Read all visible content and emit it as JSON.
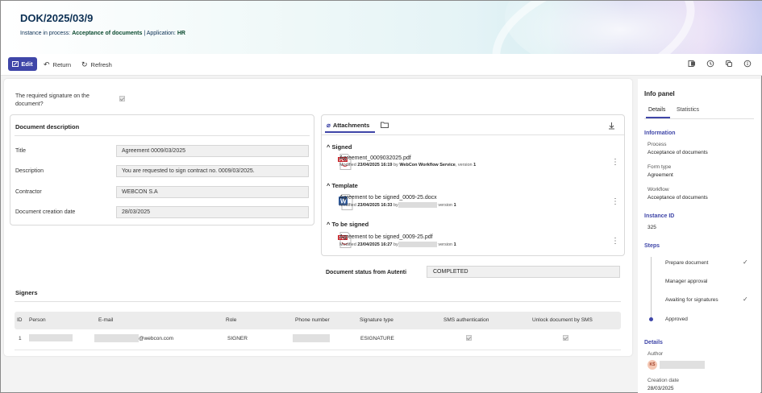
{
  "header": {
    "doc_title": "DOK/2025/03/9",
    "instance_label": "Instance in process:",
    "process_name": "Acceptance of documents",
    "app_label": "| Application:",
    "app_name": "HR"
  },
  "toolbar": {
    "edit_label": "Edit",
    "return_label": "Return",
    "refresh_label": "Refresh",
    "right_icons": [
      "excel-icon",
      "history-icon",
      "copy-icon",
      "info-icon"
    ]
  },
  "form": {
    "required_signature_label": "The required signature on the document?",
    "required_signature_checked": true,
    "doc_desc_title": "Document description",
    "fields": [
      {
        "label": "Title",
        "value": "Agreement 0009/03/2025"
      },
      {
        "label": "Description",
        "value": "You are requested to sign contract no. 0009/03/2025."
      },
      {
        "label": "Contractor",
        "value": "WEBCON S.A"
      },
      {
        "label": "Document creation date",
        "value": "28/03/2025"
      }
    ],
    "status_label": "Document status from Autenti",
    "status_value": "COMPLETED"
  },
  "attachments": {
    "tab_label": "Attachments",
    "groups": [
      {
        "name": "Signed",
        "file": "Agreement_0009032025.pdf",
        "meta_prefix": "Modified",
        "date": "23/04/2025 16:19",
        "by_label": "by",
        "author": "WebCon Workflow Service",
        "version_text": ", version",
        "version": "1",
        "type": "pdf"
      },
      {
        "name": "Template",
        "file": "Agreement to be signed_0009-25.docx",
        "meta_prefix": "Modified",
        "date": "23/04/2025 16:33",
        "by_label": "by",
        "author": "",
        "version_text": "version",
        "version": "1",
        "type": "docx"
      },
      {
        "name": "To be signed",
        "file": "Agreement to be signed_0009-25.pdf",
        "meta_prefix": "Modified",
        "date": "23/04/2025 16:27",
        "by_label": "by",
        "author": "",
        "version_text": "version",
        "version": "1",
        "type": "pdf"
      }
    ],
    "pdf_badge": "PDF",
    "word_badge": "W"
  },
  "signers": {
    "title": "Signers",
    "columns": [
      "ID",
      "Person",
      "E-mail",
      "Role",
      "Phone number",
      "Signature type",
      "SMS authentication",
      "Unlock document by SMS"
    ],
    "rows": [
      {
        "id": "1",
        "email_suffix": "@webcon.com",
        "role": "SIGNER",
        "signature_type": "ESIGNATURE",
        "sms_auth": true,
        "unlock_sms": true
      }
    ]
  },
  "info_panel": {
    "title": "Info panel",
    "tabs": [
      "Details",
      "Statistics"
    ],
    "active_tab": "Details",
    "information_title": "Information",
    "process_label": "Process",
    "process_value": "Acceptance of documents",
    "form_type_label": "Form type",
    "form_type_value": "Agreement",
    "workflow_label": "Workflow",
    "workflow_value": "Acceptance of documents",
    "instance_id_title": "Instance ID",
    "instance_id_value": "325",
    "steps_title": "Steps",
    "steps": [
      {
        "name": "Prepare document",
        "done": true
      },
      {
        "name": "Manager approval",
        "done": false
      },
      {
        "name": "Awaiting for signatures",
        "done": true
      },
      {
        "name": "Approved",
        "done": false,
        "current": true
      }
    ],
    "details_title": "Details",
    "author_label": "Author",
    "author_initials": "KŚ",
    "creation_date_label": "Creation date",
    "creation_date_value": "28/03/2025"
  },
  "colors": {
    "accent": "#3f46a8",
    "pdf_red": "#c8282e",
    "word_blue": "#2b579a"
  }
}
